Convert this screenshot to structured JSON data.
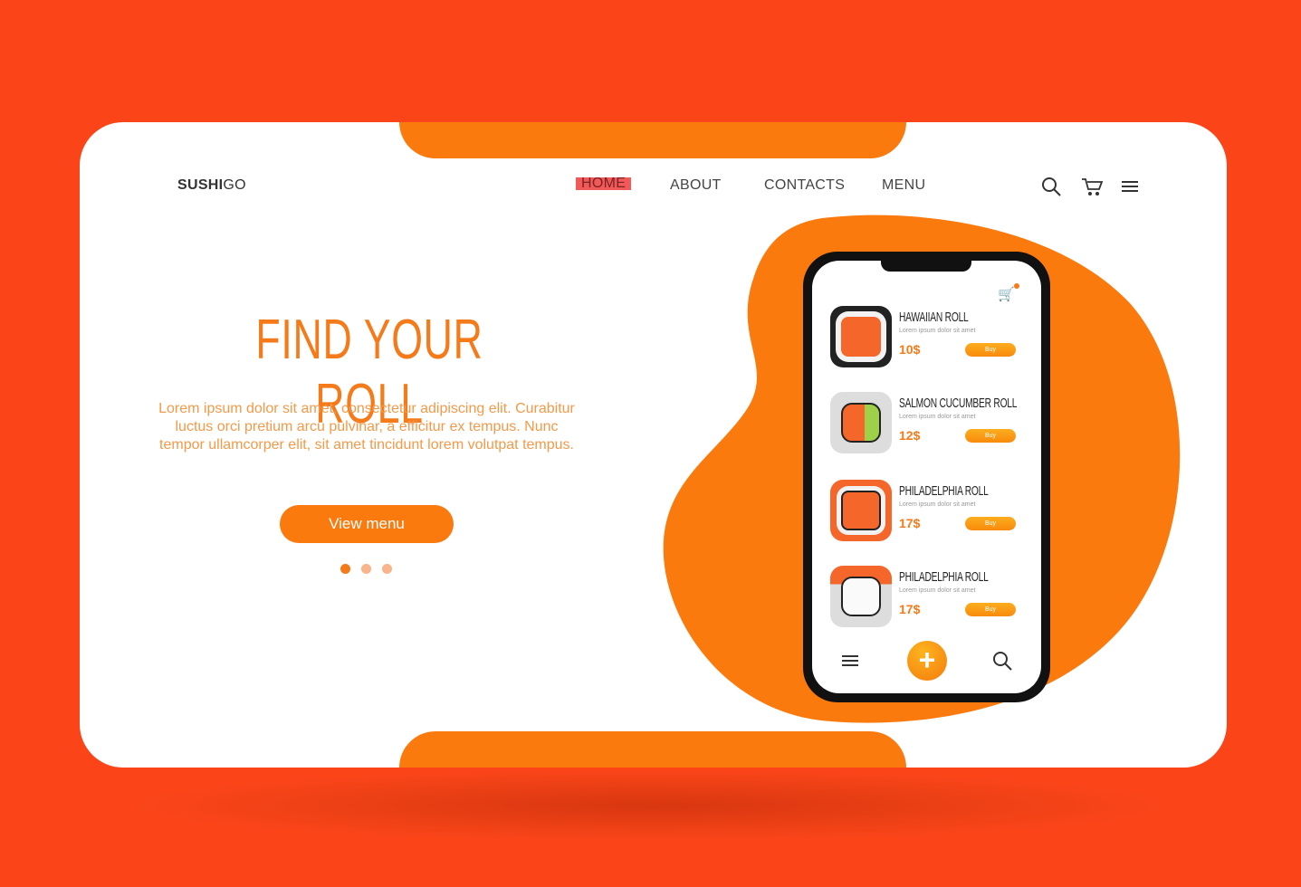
{
  "colors": {
    "background": "#fb4519",
    "accent": "#fb7a0e",
    "active_nav": "#f25a5a"
  },
  "header": {
    "logo_bold": "SUSHI",
    "logo_light": "GO",
    "nav": [
      {
        "label": "HOME",
        "active": true
      },
      {
        "label": "ABOUT"
      },
      {
        "label": "CONTACTS"
      },
      {
        "label": "MENU"
      }
    ],
    "icons": [
      "search-icon",
      "cart-icon",
      "menu-icon"
    ]
  },
  "hero": {
    "title": "FIND YOUR ROLL",
    "text": "Lorem ipsum dolor sit amet, consectetur adipiscing elit. Curabitur luctus orci pretium arcu pulvinar, a efficitur ex tempus. Nunc tempor ullamcorper elit, sit amet tincidunt lorem volutpat tempus.",
    "button": "View menu",
    "carousel": {
      "count": 3,
      "active": 1
    }
  },
  "phone": {
    "items": [
      {
        "name": "HAWAIIAN ROLL",
        "desc": "Lorem ipsum dolor sit amet",
        "price": "10$",
        "buy": "Buy"
      },
      {
        "name": "SALMON CUCUMBER ROLL",
        "desc": "Lorem ipsum dolor sit amet",
        "price": "12$",
        "buy": "Buy"
      },
      {
        "name": "PHILADELPHIA ROLL",
        "desc": "Lorem ipsum dolor sit amet",
        "price": "17$",
        "buy": "Buy"
      },
      {
        "name": "PHILADELPHIA ROLL",
        "desc": "Lorem ipsum dolor sit amet",
        "price": "17$",
        "buy": "Buy"
      }
    ],
    "fab": "+"
  }
}
